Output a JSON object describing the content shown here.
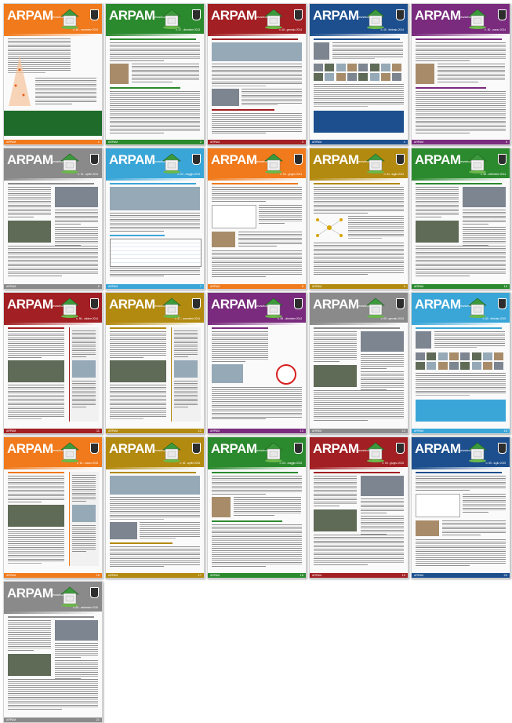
{
  "brand": {
    "logo": "ARPAM",
    "subtitle": "newsletter"
  },
  "pages": [
    {
      "color": "#f07a1c",
      "issue": "n. 46 - novembre 2013",
      "num": "1",
      "layout": "tree"
    },
    {
      "color": "#2c8a2e",
      "issue": "n. 47 - dicembre 2013",
      "num": "2",
      "layout": "text-photo"
    },
    {
      "color": "#a21f23",
      "issue": "n. 48 - gennaio 2014",
      "num": "3",
      "layout": "wide-photo"
    },
    {
      "color": "#1d4f8e",
      "issue": "n. 49 - febbraio 2014",
      "num": "4",
      "layout": "portrait-grid"
    },
    {
      "color": "#7a2b7e",
      "issue": "n. 50 - marzo 2014",
      "num": "5",
      "layout": "text-photo"
    },
    {
      "color": "#8a8a8a",
      "issue": "n. 51 - aprile 2014",
      "num": "6",
      "layout": "two-col"
    },
    {
      "color": "#3aa6d8",
      "issue": "n. 52 - maggio 2014",
      "num": "7",
      "layout": "table"
    },
    {
      "color": "#f07a1c",
      "issue": "n. 53 - giugno 2014",
      "num": "8",
      "layout": "chart"
    },
    {
      "color": "#b38a10",
      "issue": "n. 54 - luglio 2014",
      "num": "9",
      "layout": "network"
    },
    {
      "color": "#2c8a2e",
      "issue": "n. 55 - settembre 2014",
      "num": "10",
      "layout": "two-col"
    },
    {
      "color": "#a21f23",
      "issue": "n. 56 - ottobre 2014",
      "num": "11",
      "layout": "sidebar"
    },
    {
      "color": "#b38a10",
      "issue": "n. 57 - novembre 2014",
      "num": "12",
      "layout": "sidebar"
    },
    {
      "color": "#7a2b7e",
      "issue": "n. 58 - dicembre 2014",
      "num": "13",
      "layout": "sign"
    },
    {
      "color": "#8a8a8a",
      "issue": "n. 59 - gennaio 2015",
      "num": "14",
      "layout": "two-col"
    },
    {
      "color": "#3aa6d8",
      "issue": "n. 60 - febbraio 2015",
      "num": "15",
      "layout": "portrait-grid"
    },
    {
      "color": "#f07a1c",
      "issue": "n. 61 - marzo 2015",
      "num": "16",
      "layout": "sidebar"
    },
    {
      "color": "#b38a10",
      "issue": "n. 62 - aprile 2015",
      "num": "17",
      "layout": "wide-photo"
    },
    {
      "color": "#2c8a2e",
      "issue": "n. 63 - maggio 2015",
      "num": "18",
      "layout": "text-photo"
    },
    {
      "color": "#a21f23",
      "issue": "n. 64 - giugno 2015",
      "num": "19",
      "layout": "two-col"
    },
    {
      "color": "#1d4f8e",
      "issue": "n. 65 - luglio 2015",
      "num": "20",
      "layout": "chart"
    },
    {
      "color": "#8a8a8a",
      "issue": "n. 66 - settembre 2015",
      "num": "21",
      "layout": "two-col"
    }
  ]
}
